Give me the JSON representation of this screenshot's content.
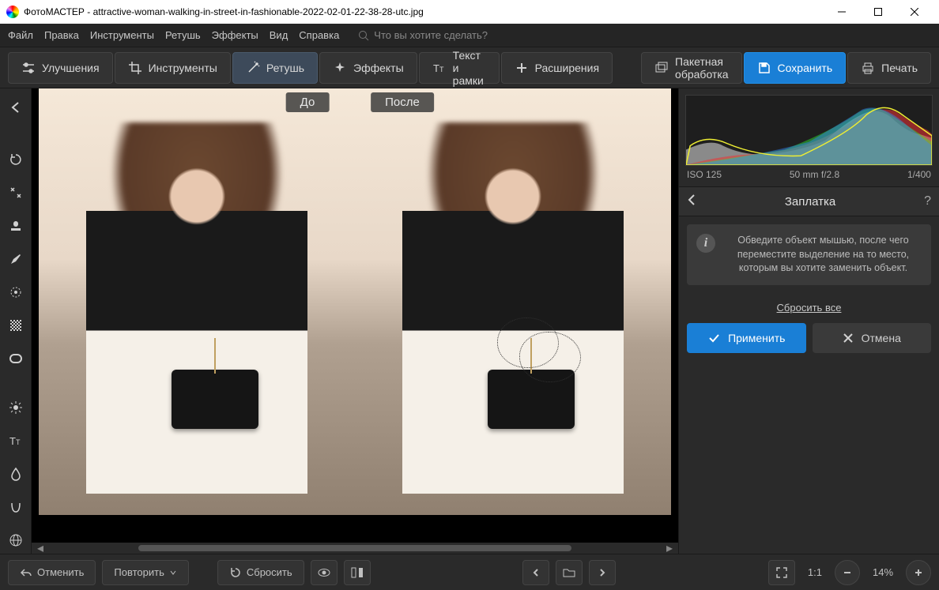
{
  "app": {
    "name": "ФотоМАСТЕР",
    "filename": "attractive-woman-walking-in-street-in-fashionable-2022-02-01-22-38-28-utc.jpg"
  },
  "menu": {
    "file": "Файл",
    "edit": "Правка",
    "tools": "Инструменты",
    "retouch": "Ретушь",
    "effects": "Эффекты",
    "view": "Вид",
    "help": "Справка",
    "search_placeholder": "Что вы хотите сделать?"
  },
  "toolbar": {
    "enhance": "Улучшения",
    "tools": "Инструменты",
    "retouch": "Ретушь",
    "effects": "Эффекты",
    "text_frames": "Текст и рамки",
    "extensions": "Расширения",
    "batch": "Пакетная обработка",
    "save": "Сохранить",
    "print": "Печать"
  },
  "canvas": {
    "before": "До",
    "after": "После"
  },
  "histogram": {
    "iso": "ISO 125",
    "lens": "50 mm f/2.8",
    "shutter": "1/400"
  },
  "panel": {
    "title": "Заплатка",
    "hint": "Обведите объект мышью, после чего переместите выделение на то место, которым вы хотите заменить объект.",
    "reset_all": "Сбросить все",
    "apply": "Применить",
    "cancel": "Отмена"
  },
  "bottom": {
    "undo": "Отменить",
    "redo": "Повторить",
    "reset": "Сбросить",
    "ratio": "1:1",
    "zoom": "14%"
  }
}
